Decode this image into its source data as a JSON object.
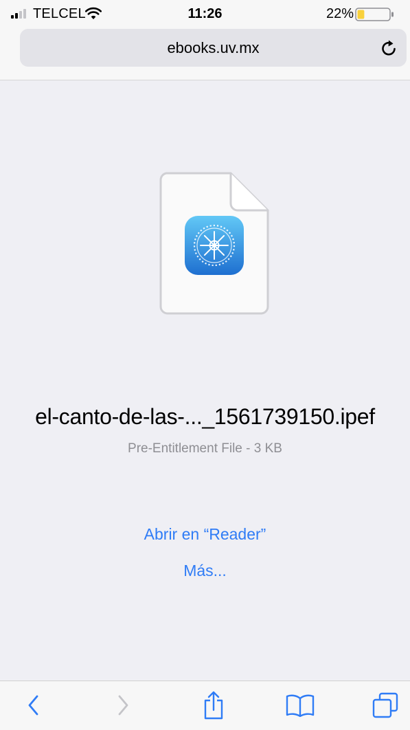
{
  "status_bar": {
    "carrier": "TELCEL",
    "time": "11:26",
    "battery_percent": "22%",
    "battery_level": 0.22,
    "signal_icon": "signal-bars-icon",
    "wifi_icon": "wifi-icon",
    "battery_icon": "battery-icon"
  },
  "browser": {
    "url": "ebooks.uv.mx",
    "reload_icon": "reload-icon"
  },
  "file": {
    "icon": "document-with-app-icon",
    "name": "el-canto-de-las-..._1561739150.ipef",
    "meta": "Pre-Entitlement File - 3 KB"
  },
  "actions": {
    "open_in": "Abrir en “Reader”",
    "more": "Más..."
  },
  "toolbar": {
    "items": [
      {
        "icon": "back-icon"
      },
      {
        "icon": "forward-icon"
      },
      {
        "icon": "share-icon"
      },
      {
        "icon": "bookmarks-icon"
      },
      {
        "icon": "tabs-icon"
      }
    ]
  },
  "colors": {
    "accent": "#2f7cf6",
    "background": "#efeff4",
    "bar": "#f7f7f7",
    "url_field": "#e3e3e8",
    "battery_low": "#f9d13c",
    "disabled": "#c4c4c8"
  }
}
